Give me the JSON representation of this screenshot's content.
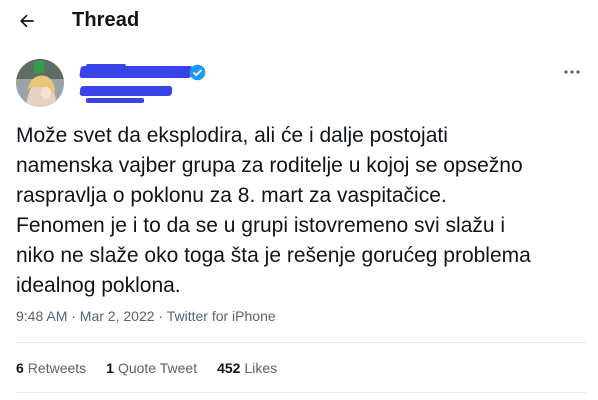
{
  "header": {
    "back_icon": "arrow-left-icon",
    "title": "Thread"
  },
  "tweet": {
    "more_icon": "more-horizontal-icon",
    "verified_icon": "verified-badge-icon",
    "verified_color": "#1d9bf0",
    "redaction_color": "#3a43e8",
    "text_lines": [
      "Može svet da eksplodira, ali će i dalje postojati",
      "namenska vajber grupa za roditelje u kojoj se opsežno",
      "raspravlja o poklonu za 8. mart za vaspitačice.",
      "Fenomen je i to da se u grupi istovremeno svi slažu i",
      "niko ne slaže oko toga šta je rešenje gorućeg problema",
      "idealnog poklona."
    ],
    "timestamp": "9:48 AM · Mar 2, 2022 · Twitter for iPhone",
    "stats": [
      {
        "count": "6",
        "label": "Retweets"
      },
      {
        "count": "1",
        "label": "Quote Tweet"
      },
      {
        "count": "452",
        "label": "Likes"
      }
    ]
  }
}
